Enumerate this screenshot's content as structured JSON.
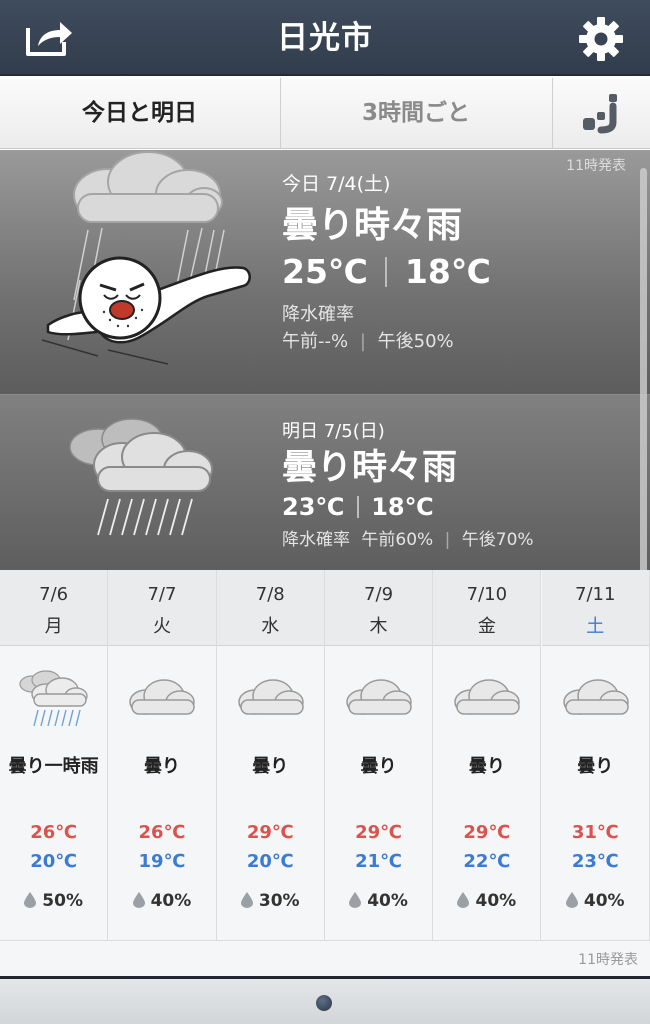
{
  "header": {
    "title": "日光市",
    "share_icon": "share-icon",
    "settings_icon": "gear-icon"
  },
  "tabs": [
    {
      "label": "今日と明日",
      "active": true
    },
    {
      "label": "3時間ごと",
      "active": false
    },
    {
      "label": "",
      "icon": "weather-app-logo-icon"
    }
  ],
  "today": {
    "release": "11時発表",
    "date": "今日 7/4(土)",
    "condition": "曇り時々雨",
    "high": "25℃",
    "low": "18℃",
    "pop_label": "降水確率",
    "pop_am": "午前--%",
    "pop_pm": "午後50%"
  },
  "tomorrow": {
    "date": "明日 7/5(日)",
    "condition": "曇り時々雨",
    "high": "23℃",
    "low": "18℃",
    "pop_label": "降水確率",
    "pop_am": "午前60%",
    "pop_pm": "午後70%"
  },
  "weekly": [
    {
      "date": "7/6",
      "weekday": "月",
      "desc": "曇り一時雨",
      "hi": "26℃",
      "lo": "20℃",
      "pop": "50%",
      "icon": "cloud-rain-icon"
    },
    {
      "date": "7/7",
      "weekday": "火",
      "desc": "曇り",
      "hi": "26℃",
      "lo": "19℃",
      "pop": "40%",
      "icon": "cloud-icon"
    },
    {
      "date": "7/8",
      "weekday": "水",
      "desc": "曇り",
      "hi": "29℃",
      "lo": "20℃",
      "pop": "30%",
      "icon": "cloud-icon"
    },
    {
      "date": "7/9",
      "weekday": "木",
      "desc": "曇り",
      "hi": "29℃",
      "lo": "21℃",
      "pop": "40%",
      "icon": "cloud-icon"
    },
    {
      "date": "7/10",
      "weekday": "金",
      "desc": "曇り",
      "hi": "29℃",
      "lo": "22℃",
      "pop": "40%",
      "icon": "cloud-icon"
    },
    {
      "date": "7/11",
      "weekday": "土",
      "desc": "曇り",
      "hi": "31℃",
      "lo": "23℃",
      "pop": "40%",
      "icon": "cloud-icon",
      "weekday_color": "#3a7bd5"
    }
  ],
  "weekly_release": "11時発表",
  "colors": {
    "header": "#3a4757",
    "high_temp": "#d9534f",
    "low_temp": "#3a7bd5"
  }
}
